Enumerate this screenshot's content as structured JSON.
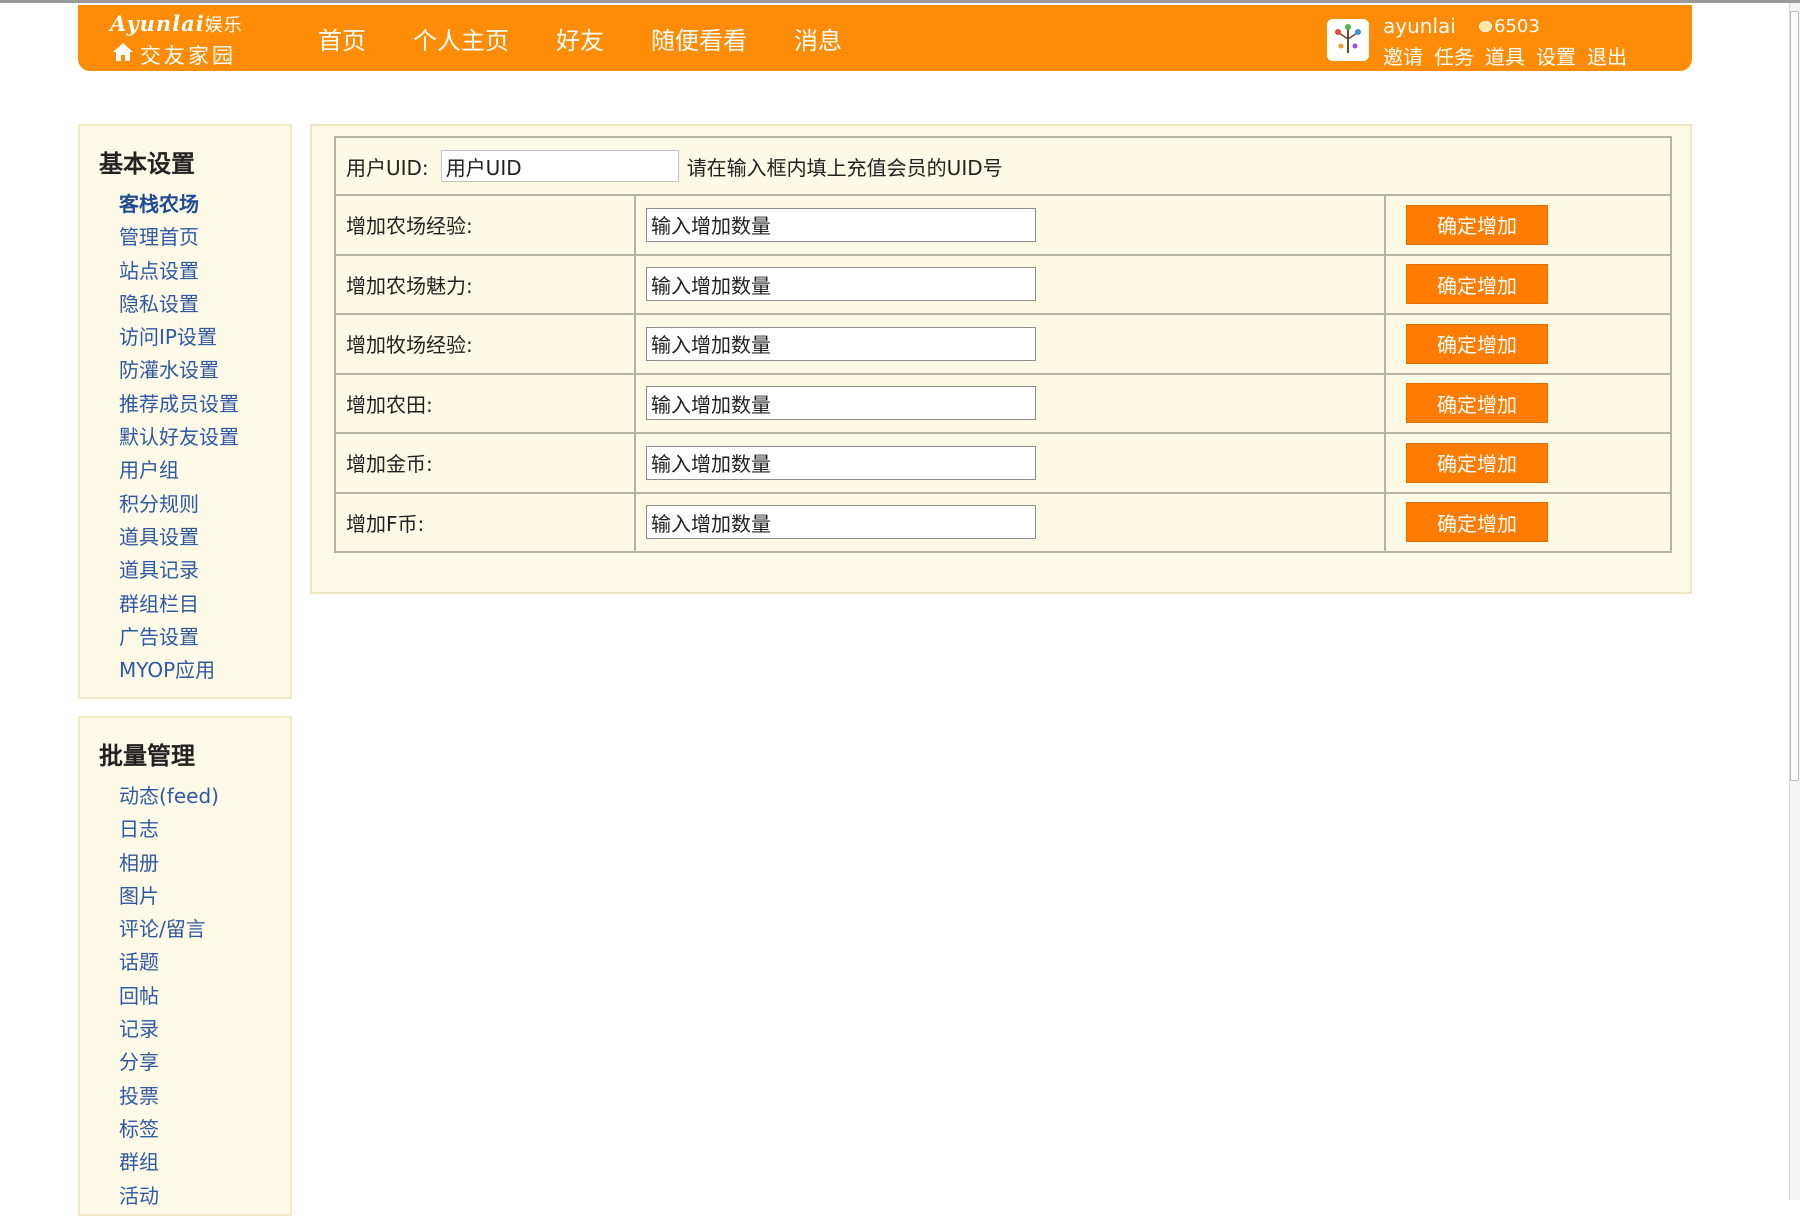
{
  "header": {
    "logo_en": "Ayunlai",
    "logo_en_suffix": "娱乐",
    "logo_cn": "交友家园",
    "nav": [
      {
        "label": "首页"
      },
      {
        "label": "个人主页"
      },
      {
        "label": "好友"
      },
      {
        "label": "随便看看"
      },
      {
        "label": "消息"
      }
    ],
    "user": {
      "name": "ayunlai",
      "credit": "6503",
      "links": [
        {
          "label": "邀请"
        },
        {
          "label": "任务"
        },
        {
          "label": "道具"
        },
        {
          "label": "设置"
        },
        {
          "label": "退出"
        }
      ]
    }
  },
  "sidebar": {
    "basic": {
      "title": "基本设置",
      "items": [
        {
          "label": "客栈农场"
        },
        {
          "label": "管理首页"
        },
        {
          "label": "站点设置"
        },
        {
          "label": "隐私设置"
        },
        {
          "label": "访问IP设置"
        },
        {
          "label": "防灌水设置"
        },
        {
          "label": "推荐成员设置"
        },
        {
          "label": "默认好友设置"
        },
        {
          "label": "用户组"
        },
        {
          "label": "积分规则"
        },
        {
          "label": "道具设置"
        },
        {
          "label": "道具记录"
        },
        {
          "label": "群组栏目"
        },
        {
          "label": "广告设置"
        },
        {
          "label": "MYOP应用"
        }
      ]
    },
    "batch": {
      "title": "批量管理",
      "items": [
        {
          "label": "动态(feed)"
        },
        {
          "label": "日志"
        },
        {
          "label": "相册"
        },
        {
          "label": "图片"
        },
        {
          "label": "评论/留言"
        },
        {
          "label": "话题"
        },
        {
          "label": "回帖"
        },
        {
          "label": "记录"
        },
        {
          "label": "分享"
        },
        {
          "label": "投票"
        },
        {
          "label": "标签"
        },
        {
          "label": "群组"
        },
        {
          "label": "活动"
        }
      ]
    }
  },
  "form": {
    "uid_label": "用户UID:",
    "uid_value": "用户UID",
    "uid_hint": "请在输入框内填上充值会员的UID号",
    "button_label": "确定增加",
    "rows": [
      {
        "label": "增加农场经验:",
        "value": "输入增加数量"
      },
      {
        "label": "增加农场魅力:",
        "value": "输入增加数量"
      },
      {
        "label": "增加牧场经验:",
        "value": "输入增加数量"
      },
      {
        "label": "增加农田:",
        "value": "输入增加数量"
      },
      {
        "label": "增加金币:",
        "value": "输入增加数量"
      },
      {
        "label": "增加F币:",
        "value": "输入增加数量"
      }
    ]
  },
  "colors": {
    "header": "#ff8c06",
    "panel_bg": "#fdfae7",
    "link": "#2f59a6",
    "button": "#ff7c00"
  }
}
